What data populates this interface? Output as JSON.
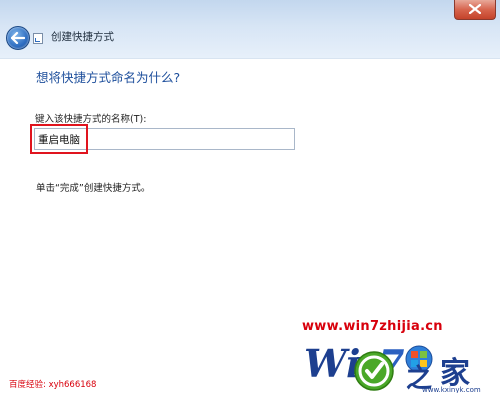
{
  "window": {
    "title": "创建快捷方式"
  },
  "page": {
    "heading": "想将快捷方式命名为什么?",
    "field_label": "键入该快捷方式的名称(T):",
    "name_value": "重启电脑",
    "hint": "单击“完成”创建快捷方式。"
  },
  "overlay": {
    "site_url": "www.win7zhijia.cn",
    "baidu_credit": "百度经验: xyh666168",
    "logo_wordmark": "Win7之家",
    "logo_url": "www.kxinyk.com",
    "accent_red": "#e0141e"
  },
  "icons": {
    "back": "back-arrow-icon",
    "close": "close-icon",
    "app": "shortcut-wizard-icon"
  }
}
